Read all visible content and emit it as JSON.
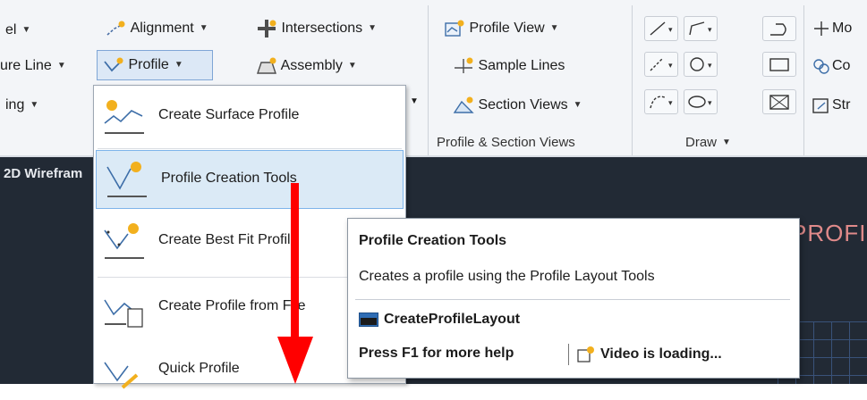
{
  "ribbon": {
    "col1": [
      "el",
      "ure Line",
      "ing"
    ],
    "col2": {
      "alignment": "Alignment",
      "profile": "Profile"
    },
    "col3": {
      "intersections": "Intersections",
      "assembly": "Assembly"
    },
    "profile_section": {
      "profile_view": "Profile View",
      "sample_lines": "Sample Lines",
      "section_views": "Section Views",
      "panel_title": "Profile & Section Views"
    },
    "draw": {
      "panel_title": "Draw"
    },
    "right_col": [
      "Mo",
      "Co",
      "Str"
    ]
  },
  "viewport": {
    "label": "2D Wirefram",
    "profile_text": "PROFI"
  },
  "profile_menu": {
    "items": [
      {
        "label": "Create Surface Profile",
        "icon": "surface-profile-icon"
      },
      {
        "label": "Profile Creation Tools",
        "icon": "profile-creation-tools-icon"
      },
      {
        "label": "Create Best Fit Profile",
        "icon": "best-fit-profile-icon"
      },
      {
        "label": "Create Profile from File",
        "icon": "profile-from-file-icon"
      },
      {
        "label": "Quick Profile",
        "icon": "quick-profile-icon"
      }
    ]
  },
  "tooltip": {
    "title": "Profile Creation Tools",
    "description": "Creates a profile using the Profile Layout Tools",
    "command": "CreateProfileLayout",
    "help": "Press F1 for more help",
    "video": "Video is loading..."
  },
  "colors": {
    "ribbon_bg": "#f3f5f8",
    "canvas_bg": "#222a35",
    "highlight": "#dbeaf6",
    "arrow": "#ff0000"
  }
}
